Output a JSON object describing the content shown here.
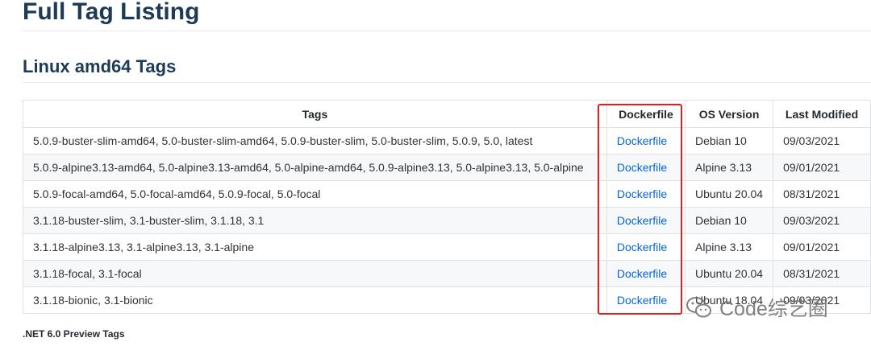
{
  "page_title": "Full Tag Listing",
  "section_title": "Linux amd64 Tags",
  "table": {
    "headers": [
      "Tags",
      "Dockerfile",
      "OS Version",
      "Last Modified"
    ],
    "rows": [
      {
        "tags": "5.0.9-buster-slim-amd64, 5.0-buster-slim-amd64, 5.0.9-buster-slim, 5.0-buster-slim, 5.0.9, 5.0, latest",
        "dockerfile": "Dockerfile",
        "os": "Debian 10",
        "modified": "09/03/2021"
      },
      {
        "tags": "5.0.9-alpine3.13-amd64, 5.0-alpine3.13-amd64, 5.0-alpine-amd64, 5.0.9-alpine3.13, 5.0-alpine3.13, 5.0-alpine",
        "dockerfile": "Dockerfile",
        "os": "Alpine 3.13",
        "modified": "09/01/2021"
      },
      {
        "tags": "5.0.9-focal-amd64, 5.0-focal-amd64, 5.0.9-focal, 5.0-focal",
        "dockerfile": "Dockerfile",
        "os": "Ubuntu 20.04",
        "modified": "08/31/2021"
      },
      {
        "tags": "3.1.18-buster-slim, 3.1-buster-slim, 3.1.18, 3.1",
        "dockerfile": "Dockerfile",
        "os": "Debian 10",
        "modified": "09/03/2021"
      },
      {
        "tags": "3.1.18-alpine3.13, 3.1-alpine3.13, 3.1-alpine",
        "dockerfile": "Dockerfile",
        "os": "Alpine 3.13",
        "modified": "09/01/2021"
      },
      {
        "tags": "3.1.18-focal, 3.1-focal",
        "dockerfile": "Dockerfile",
        "os": "Ubuntu 20.04",
        "modified": "08/31/2021"
      },
      {
        "tags": "3.1.18-bionic, 3.1-bionic",
        "dockerfile": "Dockerfile",
        "os": "Ubuntu 18.04",
        "modified": "09/03/2021"
      }
    ]
  },
  "next_section": ".NET 6.0 Preview Tags",
  "watermark": {
    "text": "Code综艺圈",
    "icon": "wechat-icon"
  },
  "colors": {
    "heading": "#1d3a57",
    "link": "#0366d6",
    "highlight": "#e0201f"
  }
}
